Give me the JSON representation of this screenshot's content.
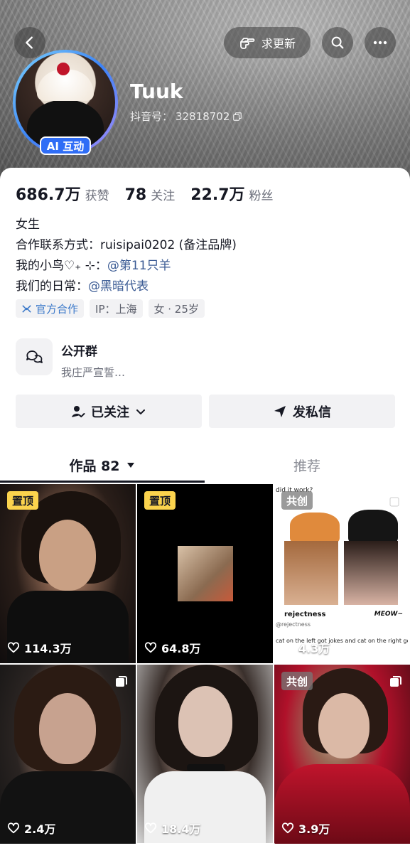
{
  "header": {
    "request_update_label": "求更新",
    "ai_badge": "AI 互动",
    "name": "Tuuk",
    "douyin_id_label": "抖音号：",
    "douyin_id_value": "32818702"
  },
  "stats": [
    {
      "value": "686.7万",
      "label": "获赞"
    },
    {
      "value": "78",
      "label": "关注"
    },
    {
      "value": "22.7万",
      "label": "粉丝"
    }
  ],
  "bio": {
    "line1": "女生",
    "line2": "合作联系方式：ruisipai0202 (备注品牌)",
    "line3_prefix": "我的小鸟♡₊ ⊹：",
    "line3_link": "@第11只羊",
    "line4_prefix": "我们的日常：",
    "line4_link": "@黑暗代表"
  },
  "tags": {
    "official": "官方合作",
    "ip": "IP：上海",
    "gender_age": "女 · 25岁"
  },
  "group": {
    "title": "公开群",
    "subtitle": "我庄严宣誓…"
  },
  "actions": {
    "follow": "已关注",
    "message": "发私信"
  },
  "tabs": {
    "works": "作品 82",
    "recommend": "推荐"
  },
  "tiles": [
    {
      "badge": "置顶",
      "likes": "114.3万"
    },
    {
      "badge": "置顶",
      "likes": "64.8万"
    },
    {
      "badge": "共创",
      "likes": "4.3万",
      "caption_top": "did it work?",
      "caption_name": "rejectness",
      "caption_handle": "@rejectness",
      "caption_meow": "MEOW~",
      "caption_bottom": "cat on the left got jokes and cat on the right go"
    },
    {
      "badge": "",
      "likes": "2.4万"
    },
    {
      "badge": "",
      "likes": "18.4万"
    },
    {
      "badge": "共创",
      "likes": "3.9万"
    }
  ],
  "colors": {
    "accent_link": "#3b5b94",
    "badge_yellow": "#fbd34d",
    "ai_badge_blue": "#2f6df6",
    "tag_blue": "#3a78c9"
  },
  "icons": [
    "back-arrow-icon",
    "hand-point-icon",
    "search-icon",
    "more-icon",
    "copy-icon",
    "official-icon",
    "chat-bubbles-icon",
    "user-check-icon",
    "chevron-down-icon",
    "send-icon",
    "caret-down-icon",
    "heart-icon",
    "multi-image-icon"
  ]
}
